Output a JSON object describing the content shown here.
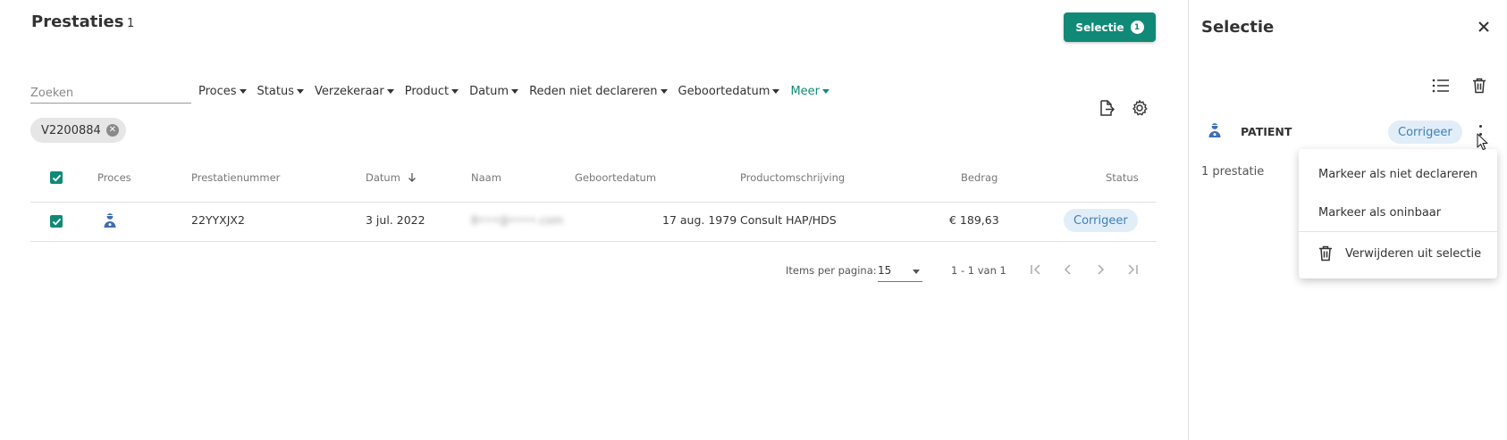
{
  "page": {
    "title": "Prestaties",
    "count": "1"
  },
  "selection_button": {
    "label": "Selectie",
    "badge": "1"
  },
  "search": {
    "placeholder": "Zoeken",
    "value": ""
  },
  "filters": [
    {
      "label": "Proces"
    },
    {
      "label": "Status"
    },
    {
      "label": "Verzekeraar"
    },
    {
      "label": "Product"
    },
    {
      "label": "Datum"
    },
    {
      "label": "Reden niet declareren"
    },
    {
      "label": "Geboortedatum"
    },
    {
      "label": "Meer"
    }
  ],
  "active_chip": {
    "label": "V2200884"
  },
  "table": {
    "headers": {
      "proces": "Proces",
      "prestatienummer": "Prestatienummer",
      "datum": "Datum",
      "naam": "Naam",
      "geboortedatum": "Geboortedatum",
      "productomschrijving": "Productomschrijving",
      "bedrag": "Bedrag",
      "status": "Status"
    },
    "sort": {
      "column": "Datum",
      "direction": "descending"
    },
    "rows": [
      {
        "checked": true,
        "proces_icon": "patient-icon",
        "prestatienummer": "22YYXJX2",
        "datum": "3 jul. 2022",
        "naam": "B•••@••••.com",
        "geboortedatum": "17 aug. 1979",
        "productomschrijving": "Consult HAP/HDS",
        "bedrag": "€ 189,63",
        "status": "Corrigeer"
      }
    ]
  },
  "pagination": {
    "items_label": "Items per pagina:",
    "page_size": "15",
    "range": "1 - 1 van 1"
  },
  "side_panel": {
    "title": "Selectie",
    "group_label": "PATIENT",
    "group_status": "Corrigeer",
    "count_text": "1 prestatie"
  },
  "context_menu": {
    "items": [
      {
        "label": "Markeer als niet declareren"
      },
      {
        "label": "Markeer als oninbaar"
      },
      {
        "label": "Verwijderen uit selectie"
      }
    ]
  },
  "colors": {
    "accent": "#108a76",
    "status_pill_bg": "#e1eef8",
    "status_pill_text": "#3d7fb8",
    "patient_icon": "#3f6fb0"
  }
}
